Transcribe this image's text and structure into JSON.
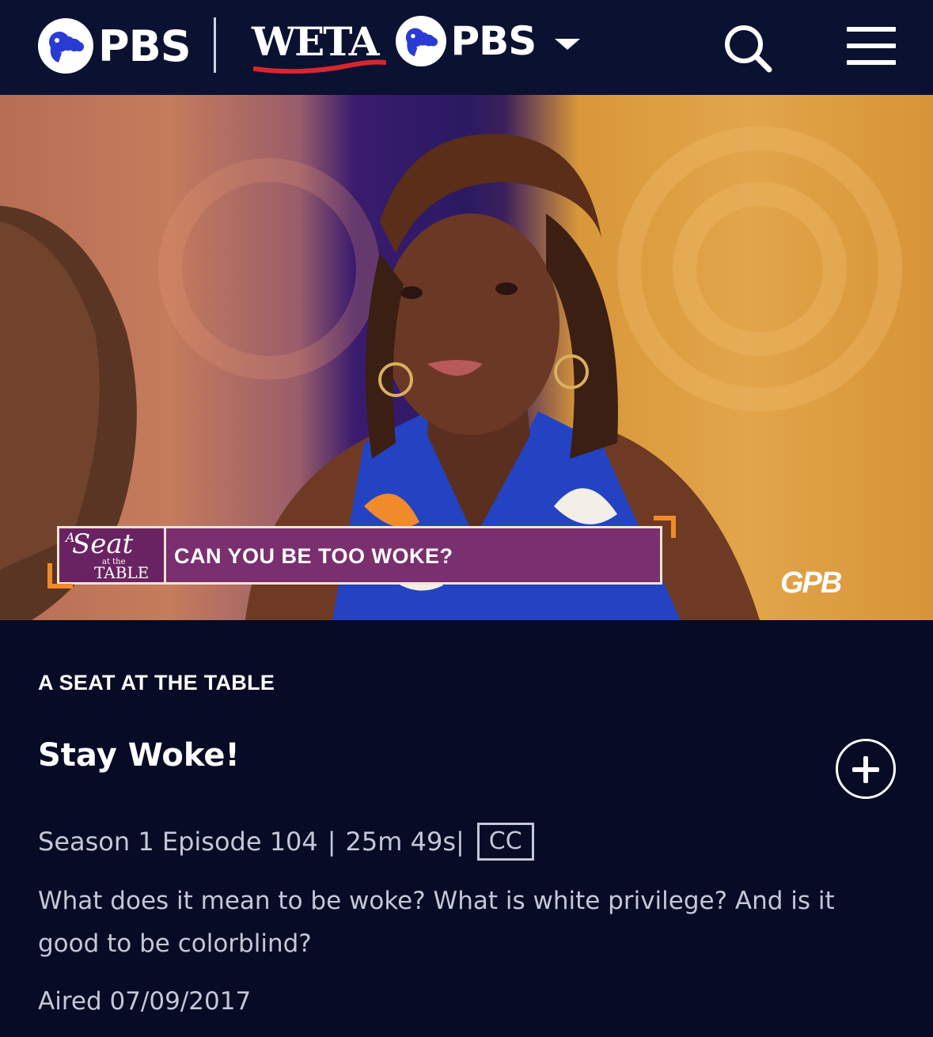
{
  "header": {
    "brand": "PBS",
    "station_name": "WETA",
    "station_brand": "PBS",
    "icons": [
      "pbs-logo-icon",
      "chevron-down-icon",
      "search-icon",
      "menu-icon"
    ]
  },
  "video": {
    "lower_third_logo": {
      "a": "A",
      "seat": "Seat",
      "at_the": "at the",
      "table": "TABLE"
    },
    "lower_third_text": "CAN YOU BE TOO WOKE?",
    "watermark": "GPB"
  },
  "episode": {
    "show_title": "A SEAT AT THE TABLE",
    "title": "Stay Woke!",
    "season_episode": "Season 1 Episode 104",
    "separator": "|",
    "duration": "25m 49s",
    "separator2": "|",
    "cc_label": "CC",
    "description": "What does it mean to be woke? What is white privilege? And is it good to be colorblind?",
    "aired": "Aired 07/09/2017"
  },
  "colors": {
    "background": "#070b25",
    "header": "#0b1130",
    "text_secondary": "#c4c7d6",
    "accent_orange": "#f08a2a",
    "lower_third_purple": "#7a2f6f",
    "weta_red": "#d7262e"
  }
}
